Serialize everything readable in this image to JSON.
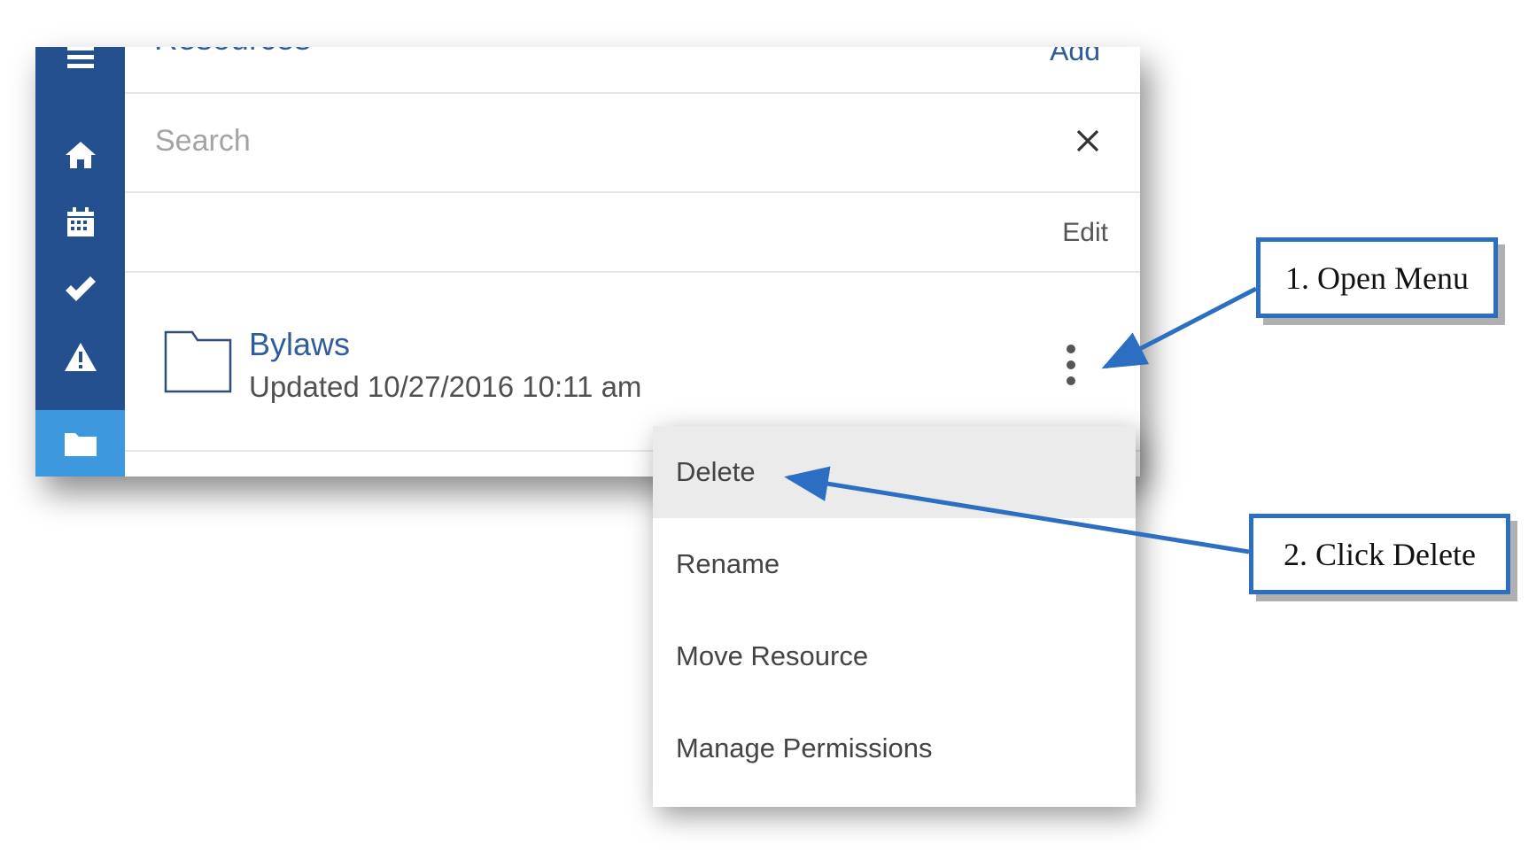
{
  "header": {
    "title": "Resources",
    "add_label": "Add"
  },
  "sidebar": {
    "items": [
      {
        "icon": "menu-icon"
      },
      {
        "icon": "home-icon"
      },
      {
        "icon": "calendar-icon"
      },
      {
        "icon": "check-icon"
      },
      {
        "icon": "warning-icon"
      },
      {
        "icon": "folder-icon",
        "active": true
      }
    ]
  },
  "search": {
    "placeholder": "Search",
    "value": ""
  },
  "list": {
    "edit_label": "Edit",
    "resources": [
      {
        "name": "Bylaws",
        "updated": "Updated 10/27/2016 10:11 am",
        "icon": "folder-icon"
      }
    ]
  },
  "menu": {
    "items": [
      {
        "label": "Delete",
        "highlighted": true
      },
      {
        "label": "Rename"
      },
      {
        "label": "Move Resource"
      },
      {
        "label": "Manage Permissions"
      }
    ]
  },
  "annotations": {
    "step1": "1. Open Menu",
    "step2": "2. Click Delete"
  },
  "colors": {
    "sidebar": "#24508f",
    "sidebar_active": "#3d98de",
    "link": "#2f5d9b",
    "annotation": "#2c6fc2",
    "menu_highlight": "#ebebeb"
  }
}
